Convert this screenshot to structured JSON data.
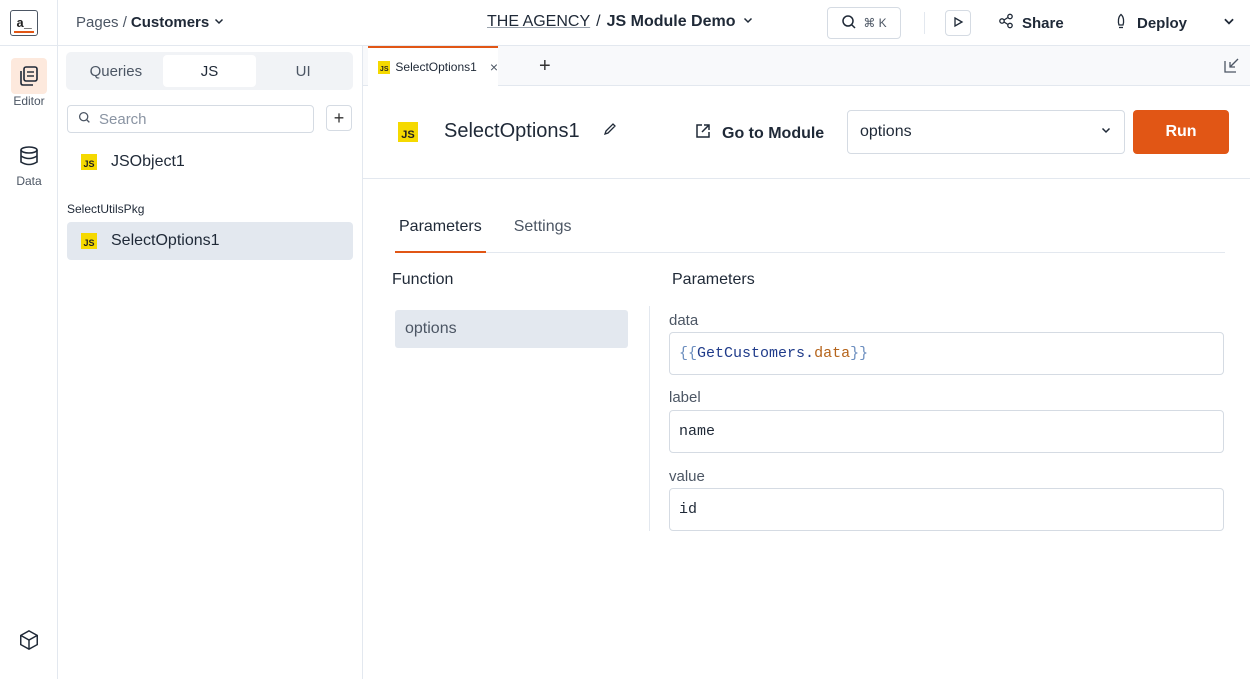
{
  "app": {
    "logo_text": "a_",
    "breadcrumb_prefix": "Pages /",
    "page_name": "Customers",
    "workspace": "THE AGENCY",
    "separator": "/",
    "app_name": "JS Module Demo",
    "cmd_shortcut": "⌘ K",
    "share_label": "Share",
    "deploy_label": "Deploy"
  },
  "rail": {
    "editor_label": "Editor",
    "data_label": "Data"
  },
  "explorer": {
    "tabs": [
      "Queries",
      "JS",
      "UI"
    ],
    "active_tab": "JS",
    "search_placeholder": "Search",
    "add_symbol": "+",
    "js_badge": "JS",
    "items": [
      {
        "label": "JSObject1"
      }
    ],
    "package_label": "SelectUtilsPkg",
    "package_items": [
      {
        "label": "SelectOptions1"
      }
    ]
  },
  "editor": {
    "tab_label": "SelectOptions1",
    "tab_close": "×",
    "tab_add": "+",
    "object_name": "SelectOptions1",
    "goto_label": "Go to Module",
    "function_value": "options",
    "run_label": "Run",
    "tabs": [
      "Parameters",
      "Settings"
    ],
    "function_heading": "Function",
    "params_heading": "Parameters",
    "functions": [
      "options"
    ],
    "params": {
      "data_label": "data",
      "data_open": "{{",
      "data_obj": "GetCustomers",
      "data_dot": ".",
      "data_prop": "data",
      "data_close": "}}",
      "label_label": "label",
      "label_value": "name",
      "value_label": "value",
      "value_value": "id"
    }
  },
  "colors": {
    "accent": "#e15615",
    "js_badge": "#f5d900",
    "selected_bg": "#e3e8ef"
  }
}
